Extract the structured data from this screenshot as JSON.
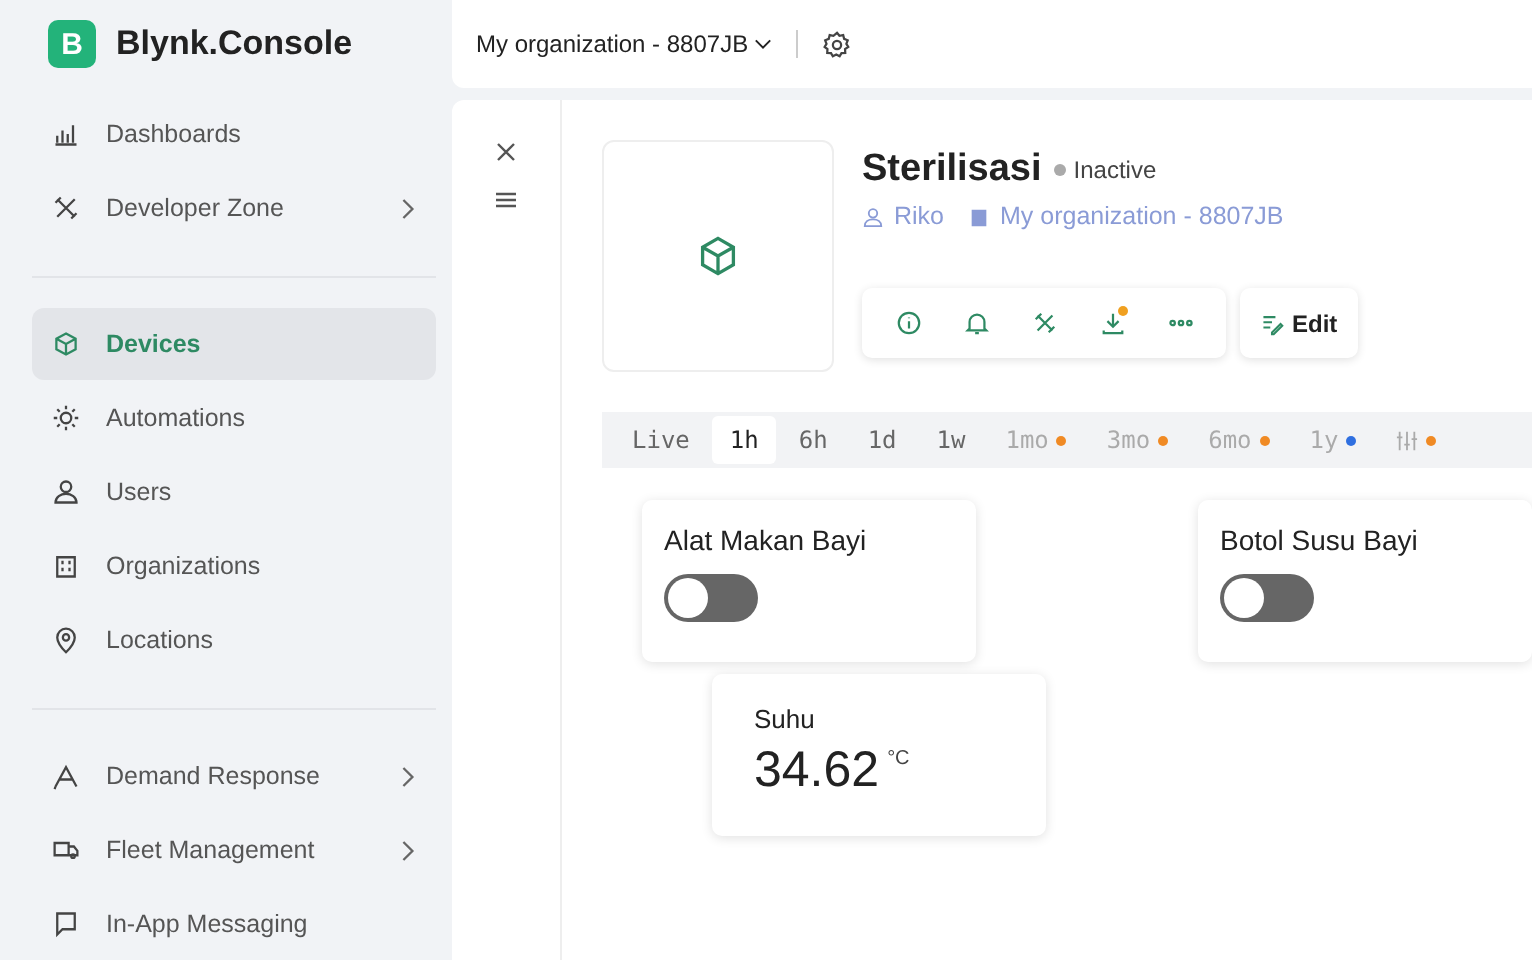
{
  "brand": {
    "logo_letter": "B",
    "name": "Blynk.Console"
  },
  "sidebar": {
    "groups": [
      {
        "items": [
          {
            "label": "Dashboards",
            "selected": false,
            "has_submenu": false
          },
          {
            "label": "Developer Zone",
            "selected": false,
            "has_submenu": true
          }
        ]
      },
      {
        "items": [
          {
            "label": "Devices",
            "selected": true,
            "has_submenu": false
          },
          {
            "label": "Automations",
            "selected": false,
            "has_submenu": false
          },
          {
            "label": "Users",
            "selected": false,
            "has_submenu": false
          },
          {
            "label": "Organizations",
            "selected": false,
            "has_submenu": false
          },
          {
            "label": "Locations",
            "selected": false,
            "has_submenu": false
          }
        ]
      },
      {
        "items": [
          {
            "label": "Demand Response",
            "selected": false,
            "has_submenu": true
          },
          {
            "label": "Fleet Management",
            "selected": false,
            "has_submenu": true
          },
          {
            "label": "In-App Messaging",
            "selected": false,
            "has_submenu": false
          }
        ]
      }
    ]
  },
  "top_bar": {
    "organization": "My organization - 8807JB"
  },
  "device": {
    "name": "Sterilisasi",
    "status": "Inactive",
    "online": false,
    "owner": "Riko",
    "organization": "My organization - 8807JB",
    "edit_label": "Edit",
    "actions": [
      {
        "kind": "info",
        "badge": false
      },
      {
        "kind": "bell",
        "badge": false
      },
      {
        "kind": "tools",
        "badge": false
      },
      {
        "kind": "download",
        "badge": true
      },
      {
        "kind": "more",
        "badge": false
      }
    ]
  },
  "time_ranges": [
    {
      "kind": "text",
      "label": "Live",
      "selected": false,
      "disabled": false
    },
    {
      "kind": "text",
      "label": "1h",
      "selected": true,
      "disabled": false
    },
    {
      "kind": "text",
      "label": "6h",
      "selected": false,
      "disabled": false
    },
    {
      "kind": "text",
      "label": "1d",
      "selected": false,
      "disabled": false
    },
    {
      "kind": "text",
      "label": "1w",
      "selected": false,
      "disabled": false
    },
    {
      "kind": "text",
      "label": "1mo",
      "selected": false,
      "disabled": true,
      "color": "#f08a24"
    },
    {
      "kind": "text",
      "label": "3mo",
      "selected": false,
      "disabled": true,
      "color": "#f08a24"
    },
    {
      "kind": "text",
      "label": "6mo",
      "selected": false,
      "disabled": true,
      "color": "#f08a24"
    },
    {
      "kind": "text",
      "label": "1y",
      "selected": false,
      "disabled": true,
      "color": "#2f6fe0"
    },
    {
      "kind": "icon",
      "selected": false,
      "disabled": true,
      "color": "#f08a24"
    }
  ],
  "widgets": [
    {
      "kind": "switch",
      "title": "Alat Makan Bayi",
      "on": false
    },
    {
      "kind": "switch",
      "title": "Botol Susu Bayi",
      "on": false
    },
    {
      "kind": "value",
      "title": "Suhu",
      "value": "34.62",
      "unit": "°C"
    }
  ]
}
